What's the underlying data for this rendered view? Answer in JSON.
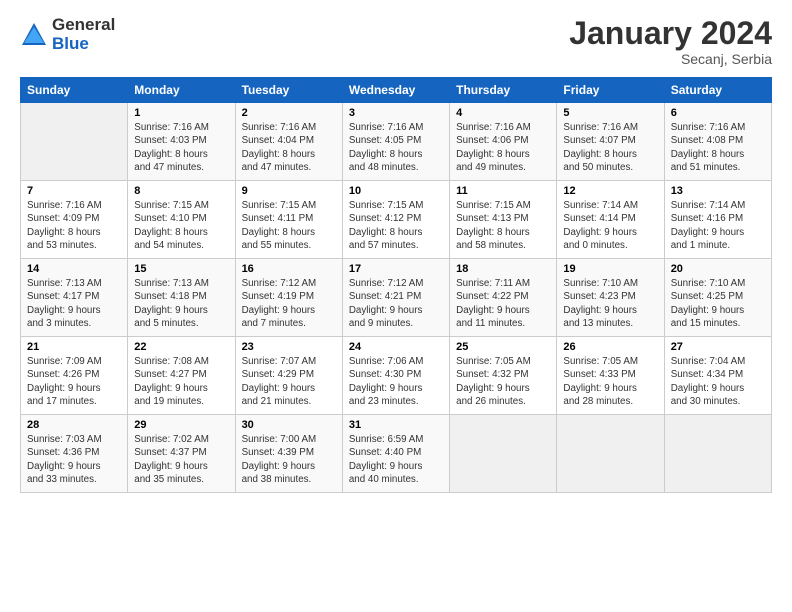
{
  "logo": {
    "general": "General",
    "blue": "Blue"
  },
  "title": "January 2024",
  "location": "Secanj, Serbia",
  "header_days": [
    "Sunday",
    "Monday",
    "Tuesday",
    "Wednesday",
    "Thursday",
    "Friday",
    "Saturday"
  ],
  "weeks": [
    [
      {
        "day": "",
        "info": ""
      },
      {
        "day": "1",
        "info": "Sunrise: 7:16 AM\nSunset: 4:03 PM\nDaylight: 8 hours\nand 47 minutes."
      },
      {
        "day": "2",
        "info": "Sunrise: 7:16 AM\nSunset: 4:04 PM\nDaylight: 8 hours\nand 47 minutes."
      },
      {
        "day": "3",
        "info": "Sunrise: 7:16 AM\nSunset: 4:05 PM\nDaylight: 8 hours\nand 48 minutes."
      },
      {
        "day": "4",
        "info": "Sunrise: 7:16 AM\nSunset: 4:06 PM\nDaylight: 8 hours\nand 49 minutes."
      },
      {
        "day": "5",
        "info": "Sunrise: 7:16 AM\nSunset: 4:07 PM\nDaylight: 8 hours\nand 50 minutes."
      },
      {
        "day": "6",
        "info": "Sunrise: 7:16 AM\nSunset: 4:08 PM\nDaylight: 8 hours\nand 51 minutes."
      }
    ],
    [
      {
        "day": "7",
        "info": "Sunrise: 7:16 AM\nSunset: 4:09 PM\nDaylight: 8 hours\nand 53 minutes."
      },
      {
        "day": "8",
        "info": "Sunrise: 7:15 AM\nSunset: 4:10 PM\nDaylight: 8 hours\nand 54 minutes."
      },
      {
        "day": "9",
        "info": "Sunrise: 7:15 AM\nSunset: 4:11 PM\nDaylight: 8 hours\nand 55 minutes."
      },
      {
        "day": "10",
        "info": "Sunrise: 7:15 AM\nSunset: 4:12 PM\nDaylight: 8 hours\nand 57 minutes."
      },
      {
        "day": "11",
        "info": "Sunrise: 7:15 AM\nSunset: 4:13 PM\nDaylight: 8 hours\nand 58 minutes."
      },
      {
        "day": "12",
        "info": "Sunrise: 7:14 AM\nSunset: 4:14 PM\nDaylight: 9 hours\nand 0 minutes."
      },
      {
        "day": "13",
        "info": "Sunrise: 7:14 AM\nSunset: 4:16 PM\nDaylight: 9 hours\nand 1 minute."
      }
    ],
    [
      {
        "day": "14",
        "info": "Sunrise: 7:13 AM\nSunset: 4:17 PM\nDaylight: 9 hours\nand 3 minutes."
      },
      {
        "day": "15",
        "info": "Sunrise: 7:13 AM\nSunset: 4:18 PM\nDaylight: 9 hours\nand 5 minutes."
      },
      {
        "day": "16",
        "info": "Sunrise: 7:12 AM\nSunset: 4:19 PM\nDaylight: 9 hours\nand 7 minutes."
      },
      {
        "day": "17",
        "info": "Sunrise: 7:12 AM\nSunset: 4:21 PM\nDaylight: 9 hours\nand 9 minutes."
      },
      {
        "day": "18",
        "info": "Sunrise: 7:11 AM\nSunset: 4:22 PM\nDaylight: 9 hours\nand 11 minutes."
      },
      {
        "day": "19",
        "info": "Sunrise: 7:10 AM\nSunset: 4:23 PM\nDaylight: 9 hours\nand 13 minutes."
      },
      {
        "day": "20",
        "info": "Sunrise: 7:10 AM\nSunset: 4:25 PM\nDaylight: 9 hours\nand 15 minutes."
      }
    ],
    [
      {
        "day": "21",
        "info": "Sunrise: 7:09 AM\nSunset: 4:26 PM\nDaylight: 9 hours\nand 17 minutes."
      },
      {
        "day": "22",
        "info": "Sunrise: 7:08 AM\nSunset: 4:27 PM\nDaylight: 9 hours\nand 19 minutes."
      },
      {
        "day": "23",
        "info": "Sunrise: 7:07 AM\nSunset: 4:29 PM\nDaylight: 9 hours\nand 21 minutes."
      },
      {
        "day": "24",
        "info": "Sunrise: 7:06 AM\nSunset: 4:30 PM\nDaylight: 9 hours\nand 23 minutes."
      },
      {
        "day": "25",
        "info": "Sunrise: 7:05 AM\nSunset: 4:32 PM\nDaylight: 9 hours\nand 26 minutes."
      },
      {
        "day": "26",
        "info": "Sunrise: 7:05 AM\nSunset: 4:33 PM\nDaylight: 9 hours\nand 28 minutes."
      },
      {
        "day": "27",
        "info": "Sunrise: 7:04 AM\nSunset: 4:34 PM\nDaylight: 9 hours\nand 30 minutes."
      }
    ],
    [
      {
        "day": "28",
        "info": "Sunrise: 7:03 AM\nSunset: 4:36 PM\nDaylight: 9 hours\nand 33 minutes."
      },
      {
        "day": "29",
        "info": "Sunrise: 7:02 AM\nSunset: 4:37 PM\nDaylight: 9 hours\nand 35 minutes."
      },
      {
        "day": "30",
        "info": "Sunrise: 7:00 AM\nSunset: 4:39 PM\nDaylight: 9 hours\nand 38 minutes."
      },
      {
        "day": "31",
        "info": "Sunrise: 6:59 AM\nSunset: 4:40 PM\nDaylight: 9 hours\nand 40 minutes."
      },
      {
        "day": "",
        "info": ""
      },
      {
        "day": "",
        "info": ""
      },
      {
        "day": "",
        "info": ""
      }
    ]
  ]
}
